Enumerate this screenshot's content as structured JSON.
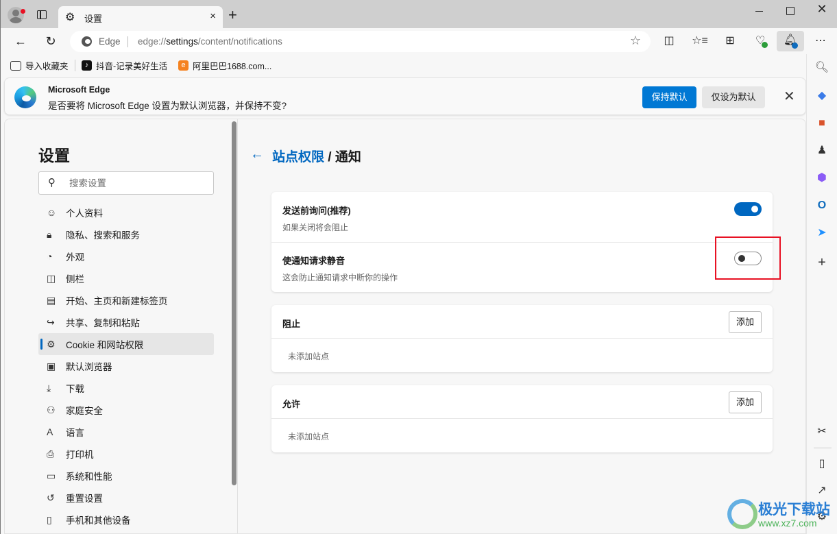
{
  "window": {
    "tab_title": "设置",
    "new_tab": "+",
    "close_tab": "×"
  },
  "navbar": {
    "site_label": "Edge",
    "url_prefix": "edge://",
    "url_host": "settings",
    "url_path": "/content/notifications",
    "notification_badge": "1"
  },
  "favorites": [
    {
      "label": "导入收藏夹",
      "icon": "import-favorites-icon"
    },
    {
      "label": "抖音-记录美好生活",
      "icon": "douyin-icon"
    },
    {
      "label": "阿里巴巴1688.com...",
      "icon": "alibaba-icon"
    }
  ],
  "infobar": {
    "title": "Microsoft Edge",
    "message": "是否要将 Microsoft Edge 设置为默认浏览器，并保持不变?",
    "primary_button": "保持默认",
    "secondary_button": "仅设为默认"
  },
  "sidebar": {
    "title": "设置",
    "search_placeholder": "搜索设置",
    "items": [
      {
        "label": "个人资料",
        "icon": "profile-icon",
        "active": false
      },
      {
        "label": "隐私、搜索和服务",
        "icon": "lock-icon",
        "active": false
      },
      {
        "label": "外观",
        "icon": "palette-icon",
        "active": false
      },
      {
        "label": "侧栏",
        "icon": "sidebar-icon",
        "active": false
      },
      {
        "label": "开始、主页和新建标签页",
        "icon": "home-tab-icon",
        "active": false
      },
      {
        "label": "共享、复制和粘贴",
        "icon": "share-icon",
        "active": false
      },
      {
        "label": "Cookie 和网站权限",
        "icon": "cookie-permissions-icon",
        "active": true
      },
      {
        "label": "默认浏览器",
        "icon": "default-browser-icon",
        "active": false
      },
      {
        "label": "下载",
        "icon": "download-icon",
        "active": false
      },
      {
        "label": "家庭安全",
        "icon": "family-icon",
        "active": false
      },
      {
        "label": "语言",
        "icon": "language-icon",
        "active": false
      },
      {
        "label": "打印机",
        "icon": "printer-icon",
        "active": false
      },
      {
        "label": "系统和性能",
        "icon": "laptop-icon",
        "active": false
      },
      {
        "label": "重置设置",
        "icon": "reset-icon",
        "active": false
      },
      {
        "label": "手机和其他设备",
        "icon": "phone-icon",
        "active": false
      }
    ]
  },
  "content": {
    "breadcrumb_parent": "站点权限",
    "breadcrumb_sep": " / ",
    "breadcrumb_current": "通知",
    "settings": [
      {
        "title": "发送前询问(推荐)",
        "subtitle": "如果关闭将会阻止",
        "enabled": true
      },
      {
        "title": "使通知请求静音",
        "subtitle": "这会防止通知请求中断你的操作",
        "enabled": false
      }
    ],
    "block": {
      "title": "阻止",
      "add_label": "添加",
      "empty_text": "未添加站点"
    },
    "allow": {
      "title": "允许",
      "add_label": "添加",
      "empty_text": "未添加站点"
    }
  },
  "watermark": {
    "title": "极光下载站",
    "url": "www.xz7.com"
  }
}
